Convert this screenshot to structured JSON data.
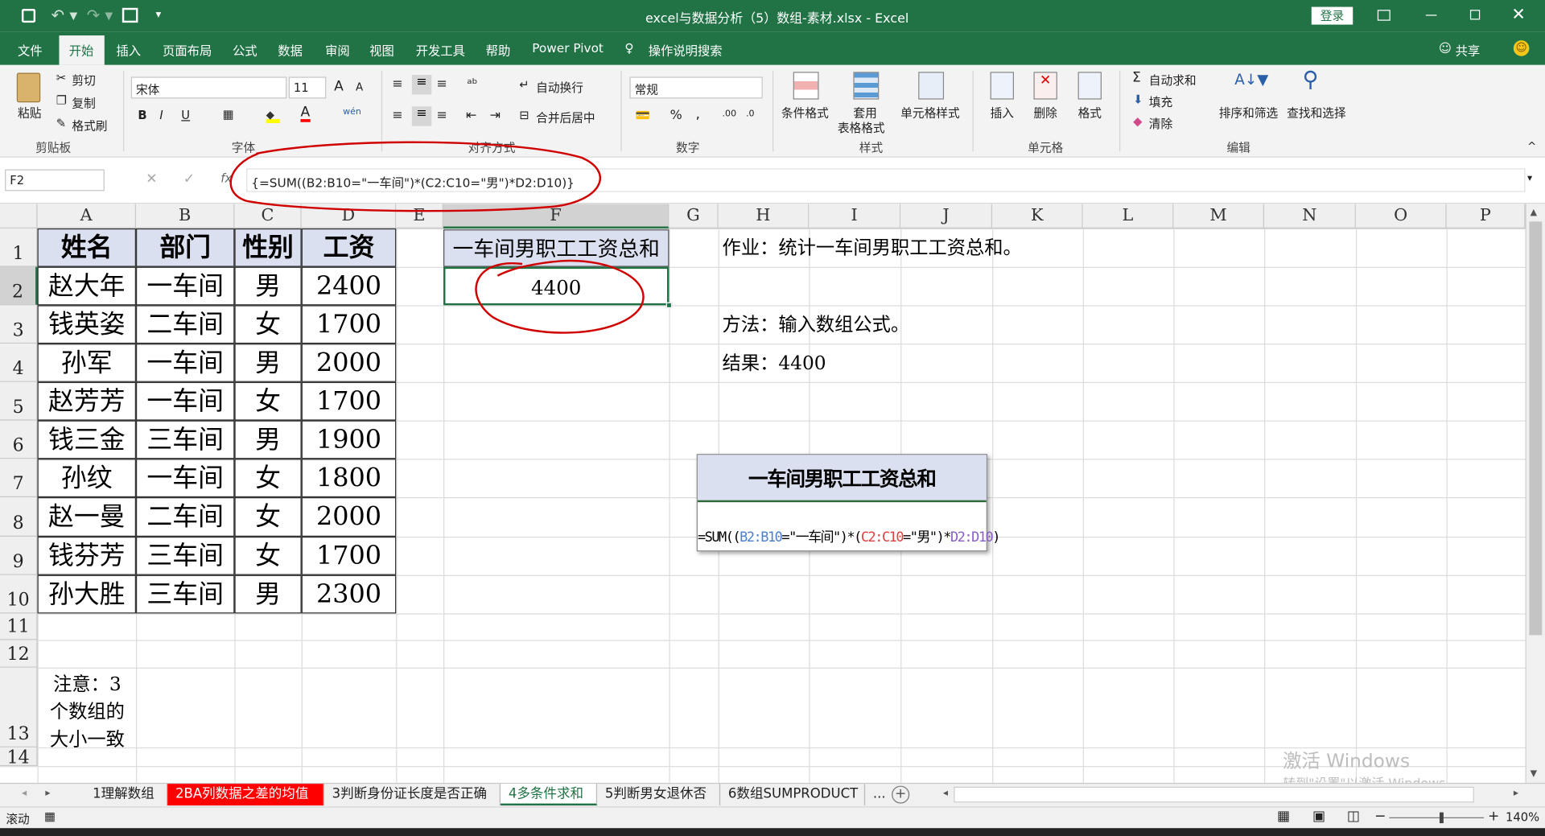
{
  "titlebar": {
    "title": "excel与数据分析（5）数组-素材.xlsx - Excel",
    "login": "登录"
  },
  "menu_tabs": [
    "文件",
    "开始",
    "插入",
    "页面布局",
    "公式",
    "数据",
    "审阅",
    "视图",
    "开发工具",
    "帮助",
    "Power Pivot",
    "操作说明搜索"
  ],
  "share": "共享",
  "ribbon": {
    "clipboard": {
      "paste": "粘贴",
      "cut": "剪切",
      "copy": "复制",
      "format_painter": "格式刷",
      "group": "剪贴板"
    },
    "font": {
      "name": "宋体",
      "size": "11",
      "bold": "B",
      "italic": "I",
      "underline": "U",
      "group": "字体",
      "grow": "A",
      "shrink": "A",
      "font_color": "A",
      "wen": "wén"
    },
    "alignment": {
      "wrap": "自动换行",
      "merge": "合并后居中",
      "group": "对齐方式"
    },
    "number": {
      "format": "常规",
      "group": "数字",
      "percent": "%",
      "comma": ","
    },
    "styles": {
      "conditional": "条件格式",
      "table1": "套用",
      "table2": "表格格式",
      "cell_styles": "单元格样式",
      "group": "样式"
    },
    "cells": {
      "insert": "插入",
      "delete": "删除",
      "format": "格式",
      "group": "单元格"
    },
    "editing": {
      "autosum": "自动求和",
      "fill": "填充",
      "clear": "清除",
      "sort": "排序和筛选",
      "find": "查找和选择",
      "group": "编辑"
    }
  },
  "formula_bar": {
    "name_box": "F2",
    "fx": "fx",
    "formula": "{=SUM((B2:B10=\"一车间\")*(C2:C10=\"男\")*D2:D10)}"
  },
  "columns": [
    "A",
    "B",
    "C",
    "D",
    "E",
    "F",
    "G",
    "H",
    "I",
    "J",
    "K",
    "L",
    "M",
    "N",
    "O",
    "P"
  ],
  "rows": [
    "1",
    "2",
    "3",
    "4",
    "5",
    "6",
    "7",
    "8",
    "9",
    "10",
    "11",
    "12",
    "13",
    "14"
  ],
  "table": {
    "headers": [
      "姓名",
      "部门",
      "性别",
      "工资"
    ],
    "rows": [
      [
        "赵大年",
        "一车间",
        "男",
        "2400"
      ],
      [
        "钱英姿",
        "二车间",
        "女",
        "1700"
      ],
      [
        "孙军",
        "一车间",
        "男",
        "2000"
      ],
      [
        "赵芳芳",
        "一车间",
        "女",
        "1700"
      ],
      [
        "钱三金",
        "三车间",
        "男",
        "1900"
      ],
      [
        "孙纹",
        "一车间",
        "女",
        "1800"
      ],
      [
        "赵一曼",
        "二车间",
        "女",
        "2000"
      ],
      [
        "钱芬芳",
        "三车间",
        "女",
        "1700"
      ],
      [
        "孙大胜",
        "三车间",
        "男",
        "2300"
      ]
    ]
  },
  "result": {
    "header": "一车间男职工工资总和",
    "value": "4400"
  },
  "notes": {
    "task": "作业：统计一车间男职工工资总和。",
    "method": "方法：输入数组公式。",
    "result": "结果：4400",
    "note_line1": "注意：3",
    "note_line2": "个数组的",
    "note_line3": "大小一致"
  },
  "textbox": {
    "title": "一车间男职工工资总和",
    "formula_parts": [
      "=SUM((",
      "B2:B10",
      "=\"一车间\")*(",
      "C2:C10",
      "=\"男\")*",
      "D2:D10",
      ")"
    ]
  },
  "sheet_tabs": [
    "1理解数组",
    "2BA列数据之差的均值",
    "3判断身份证长度是否正确",
    "4多条件求和",
    "5判断男女退休否",
    "6数组SUMPRODUCT",
    "..."
  ],
  "status": {
    "mode": "滚动",
    "zoom": "140%"
  },
  "watermark": {
    "line1": "激活 Windows",
    "line2": "转到\"设置\"以激活 Windows。"
  },
  "colors": {
    "excel_green": "#217346",
    "header_fill": "#dae0f0",
    "red_tab": "#ff0000",
    "annotation_red": "#d00000"
  }
}
